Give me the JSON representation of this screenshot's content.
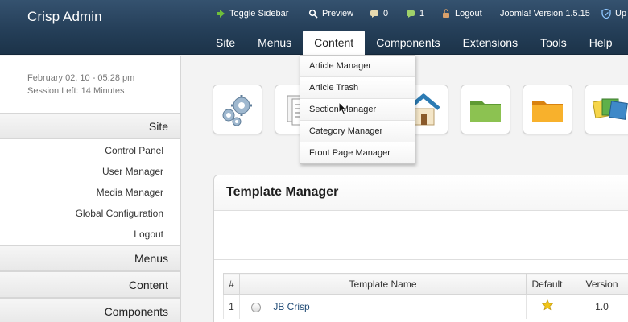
{
  "header": {
    "brand": "Crisp Admin",
    "links": [
      {
        "label": "Toggle Sidebar",
        "icon": "toggle-sidebar-icon"
      },
      {
        "label": "Preview",
        "icon": "preview-icon"
      },
      {
        "label": "0",
        "icon": "messages-icon"
      },
      {
        "label": "1",
        "icon": "users-online-icon"
      },
      {
        "label": "Logout",
        "icon": "logout-icon"
      }
    ],
    "version": "Joomla! Version 1.5.15",
    "help_link": "Up"
  },
  "nav": {
    "items": [
      "Site",
      "Menus",
      "Content",
      "Components",
      "Extensions",
      "Tools",
      "Help"
    ],
    "active": "Content"
  },
  "content_menu": {
    "items": [
      "Article Manager",
      "Article Trash",
      "Section Manager",
      "Category Manager",
      "Front Page Manager"
    ]
  },
  "sidebar": {
    "date": "February 02, 10 - 05:28 pm",
    "session": "Session Left: 14 Minutes",
    "sections": [
      "Site",
      "Menus",
      "Content",
      "Components"
    ],
    "site_links": [
      "Control Panel",
      "User Manager",
      "Media Manager",
      "Global Configuration",
      "Logout"
    ]
  },
  "quickicons": [
    "configuration-gears-icon",
    "articles-document-icon",
    "home-icon",
    "green-folder-icon",
    "orange-folder-icon",
    "media-pictures-icon"
  ],
  "panel": {
    "title": "Template Manager",
    "columns": [
      "#",
      "Template Name",
      "Default",
      "Version"
    ],
    "rows": [
      {
        "num": "1",
        "name": "JB Crisp",
        "default": true,
        "version": "1.0"
      }
    ]
  },
  "colors": {
    "header_bg": "#253f59",
    "link_blue": "#1f4a75",
    "star": "#f0c419"
  }
}
